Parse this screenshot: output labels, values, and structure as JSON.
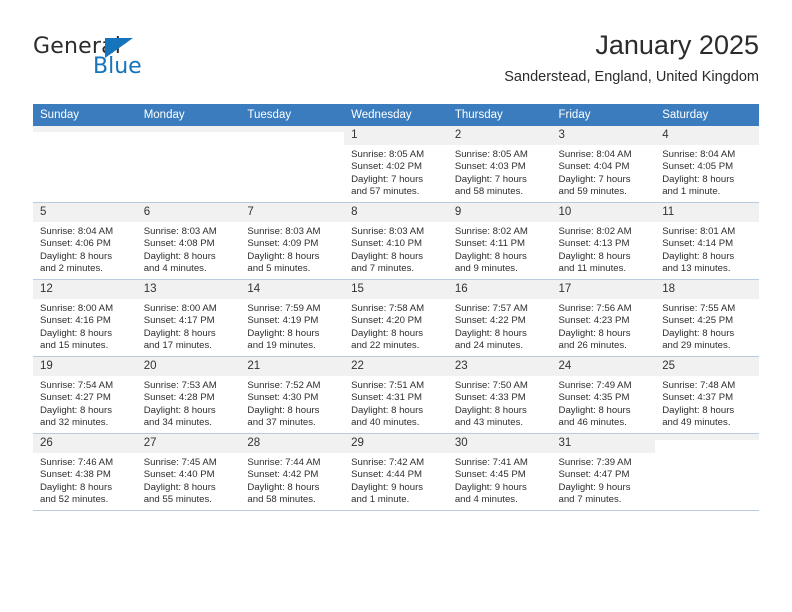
{
  "brand": {
    "name_part1": "General",
    "name_part2": "Blue",
    "accent_color": "#1574bb"
  },
  "header": {
    "title": "January 2025",
    "location": "Sanderstead, England, United Kingdom"
  },
  "calendar": {
    "header_bg": "#3a7cbe",
    "weekdays": [
      "Sunday",
      "Monday",
      "Tuesday",
      "Wednesday",
      "Thursday",
      "Friday",
      "Saturday"
    ],
    "weeks": [
      [
        {
          "day": "",
          "empty": true,
          "sunrise": "",
          "sunset": "",
          "daylight1": "",
          "daylight2": ""
        },
        {
          "day": "",
          "empty": true,
          "sunrise": "",
          "sunset": "",
          "daylight1": "",
          "daylight2": ""
        },
        {
          "day": "",
          "empty": true,
          "sunrise": "",
          "sunset": "",
          "daylight1": "",
          "daylight2": ""
        },
        {
          "day": "1",
          "empty": false,
          "sunrise": "Sunrise: 8:05 AM",
          "sunset": "Sunset: 4:02 PM",
          "daylight1": "Daylight: 7 hours",
          "daylight2": "and 57 minutes."
        },
        {
          "day": "2",
          "empty": false,
          "sunrise": "Sunrise: 8:05 AM",
          "sunset": "Sunset: 4:03 PM",
          "daylight1": "Daylight: 7 hours",
          "daylight2": "and 58 minutes."
        },
        {
          "day": "3",
          "empty": false,
          "sunrise": "Sunrise: 8:04 AM",
          "sunset": "Sunset: 4:04 PM",
          "daylight1": "Daylight: 7 hours",
          "daylight2": "and 59 minutes."
        },
        {
          "day": "4",
          "empty": false,
          "sunrise": "Sunrise: 8:04 AM",
          "sunset": "Sunset: 4:05 PM",
          "daylight1": "Daylight: 8 hours",
          "daylight2": "and 1 minute."
        }
      ],
      [
        {
          "day": "5",
          "empty": false,
          "sunrise": "Sunrise: 8:04 AM",
          "sunset": "Sunset: 4:06 PM",
          "daylight1": "Daylight: 8 hours",
          "daylight2": "and 2 minutes."
        },
        {
          "day": "6",
          "empty": false,
          "sunrise": "Sunrise: 8:03 AM",
          "sunset": "Sunset: 4:08 PM",
          "daylight1": "Daylight: 8 hours",
          "daylight2": "and 4 minutes."
        },
        {
          "day": "7",
          "empty": false,
          "sunrise": "Sunrise: 8:03 AM",
          "sunset": "Sunset: 4:09 PM",
          "daylight1": "Daylight: 8 hours",
          "daylight2": "and 5 minutes."
        },
        {
          "day": "8",
          "empty": false,
          "sunrise": "Sunrise: 8:03 AM",
          "sunset": "Sunset: 4:10 PM",
          "daylight1": "Daylight: 8 hours",
          "daylight2": "and 7 minutes."
        },
        {
          "day": "9",
          "empty": false,
          "sunrise": "Sunrise: 8:02 AM",
          "sunset": "Sunset: 4:11 PM",
          "daylight1": "Daylight: 8 hours",
          "daylight2": "and 9 minutes."
        },
        {
          "day": "10",
          "empty": false,
          "sunrise": "Sunrise: 8:02 AM",
          "sunset": "Sunset: 4:13 PM",
          "daylight1": "Daylight: 8 hours",
          "daylight2": "and 11 minutes."
        },
        {
          "day": "11",
          "empty": false,
          "sunrise": "Sunrise: 8:01 AM",
          "sunset": "Sunset: 4:14 PM",
          "daylight1": "Daylight: 8 hours",
          "daylight2": "and 13 minutes."
        }
      ],
      [
        {
          "day": "12",
          "empty": false,
          "sunrise": "Sunrise: 8:00 AM",
          "sunset": "Sunset: 4:16 PM",
          "daylight1": "Daylight: 8 hours",
          "daylight2": "and 15 minutes."
        },
        {
          "day": "13",
          "empty": false,
          "sunrise": "Sunrise: 8:00 AM",
          "sunset": "Sunset: 4:17 PM",
          "daylight1": "Daylight: 8 hours",
          "daylight2": "and 17 minutes."
        },
        {
          "day": "14",
          "empty": false,
          "sunrise": "Sunrise: 7:59 AM",
          "sunset": "Sunset: 4:19 PM",
          "daylight1": "Daylight: 8 hours",
          "daylight2": "and 19 minutes."
        },
        {
          "day": "15",
          "empty": false,
          "sunrise": "Sunrise: 7:58 AM",
          "sunset": "Sunset: 4:20 PM",
          "daylight1": "Daylight: 8 hours",
          "daylight2": "and 22 minutes."
        },
        {
          "day": "16",
          "empty": false,
          "sunrise": "Sunrise: 7:57 AM",
          "sunset": "Sunset: 4:22 PM",
          "daylight1": "Daylight: 8 hours",
          "daylight2": "and 24 minutes."
        },
        {
          "day": "17",
          "empty": false,
          "sunrise": "Sunrise: 7:56 AM",
          "sunset": "Sunset: 4:23 PM",
          "daylight1": "Daylight: 8 hours",
          "daylight2": "and 26 minutes."
        },
        {
          "day": "18",
          "empty": false,
          "sunrise": "Sunrise: 7:55 AM",
          "sunset": "Sunset: 4:25 PM",
          "daylight1": "Daylight: 8 hours",
          "daylight2": "and 29 minutes."
        }
      ],
      [
        {
          "day": "19",
          "empty": false,
          "sunrise": "Sunrise: 7:54 AM",
          "sunset": "Sunset: 4:27 PM",
          "daylight1": "Daylight: 8 hours",
          "daylight2": "and 32 minutes."
        },
        {
          "day": "20",
          "empty": false,
          "sunrise": "Sunrise: 7:53 AM",
          "sunset": "Sunset: 4:28 PM",
          "daylight1": "Daylight: 8 hours",
          "daylight2": "and 34 minutes."
        },
        {
          "day": "21",
          "empty": false,
          "sunrise": "Sunrise: 7:52 AM",
          "sunset": "Sunset: 4:30 PM",
          "daylight1": "Daylight: 8 hours",
          "daylight2": "and 37 minutes."
        },
        {
          "day": "22",
          "empty": false,
          "sunrise": "Sunrise: 7:51 AM",
          "sunset": "Sunset: 4:31 PM",
          "daylight1": "Daylight: 8 hours",
          "daylight2": "and 40 minutes."
        },
        {
          "day": "23",
          "empty": false,
          "sunrise": "Sunrise: 7:50 AM",
          "sunset": "Sunset: 4:33 PM",
          "daylight1": "Daylight: 8 hours",
          "daylight2": "and 43 minutes."
        },
        {
          "day": "24",
          "empty": false,
          "sunrise": "Sunrise: 7:49 AM",
          "sunset": "Sunset: 4:35 PM",
          "daylight1": "Daylight: 8 hours",
          "daylight2": "and 46 minutes."
        },
        {
          "day": "25",
          "empty": false,
          "sunrise": "Sunrise: 7:48 AM",
          "sunset": "Sunset: 4:37 PM",
          "daylight1": "Daylight: 8 hours",
          "daylight2": "and 49 minutes."
        }
      ],
      [
        {
          "day": "26",
          "empty": false,
          "sunrise": "Sunrise: 7:46 AM",
          "sunset": "Sunset: 4:38 PM",
          "daylight1": "Daylight: 8 hours",
          "daylight2": "and 52 minutes."
        },
        {
          "day": "27",
          "empty": false,
          "sunrise": "Sunrise: 7:45 AM",
          "sunset": "Sunset: 4:40 PM",
          "daylight1": "Daylight: 8 hours",
          "daylight2": "and 55 minutes."
        },
        {
          "day": "28",
          "empty": false,
          "sunrise": "Sunrise: 7:44 AM",
          "sunset": "Sunset: 4:42 PM",
          "daylight1": "Daylight: 8 hours",
          "daylight2": "and 58 minutes."
        },
        {
          "day": "29",
          "empty": false,
          "sunrise": "Sunrise: 7:42 AM",
          "sunset": "Sunset: 4:44 PM",
          "daylight1": "Daylight: 9 hours",
          "daylight2": "and 1 minute."
        },
        {
          "day": "30",
          "empty": false,
          "sunrise": "Sunrise: 7:41 AM",
          "sunset": "Sunset: 4:45 PM",
          "daylight1": "Daylight: 9 hours",
          "daylight2": "and 4 minutes."
        },
        {
          "day": "31",
          "empty": false,
          "sunrise": "Sunrise: 7:39 AM",
          "sunset": "Sunset: 4:47 PM",
          "daylight1": "Daylight: 9 hours",
          "daylight2": "and 7 minutes."
        },
        {
          "day": "",
          "empty": true,
          "sunrise": "",
          "sunset": "",
          "daylight1": "",
          "daylight2": ""
        }
      ]
    ]
  }
}
